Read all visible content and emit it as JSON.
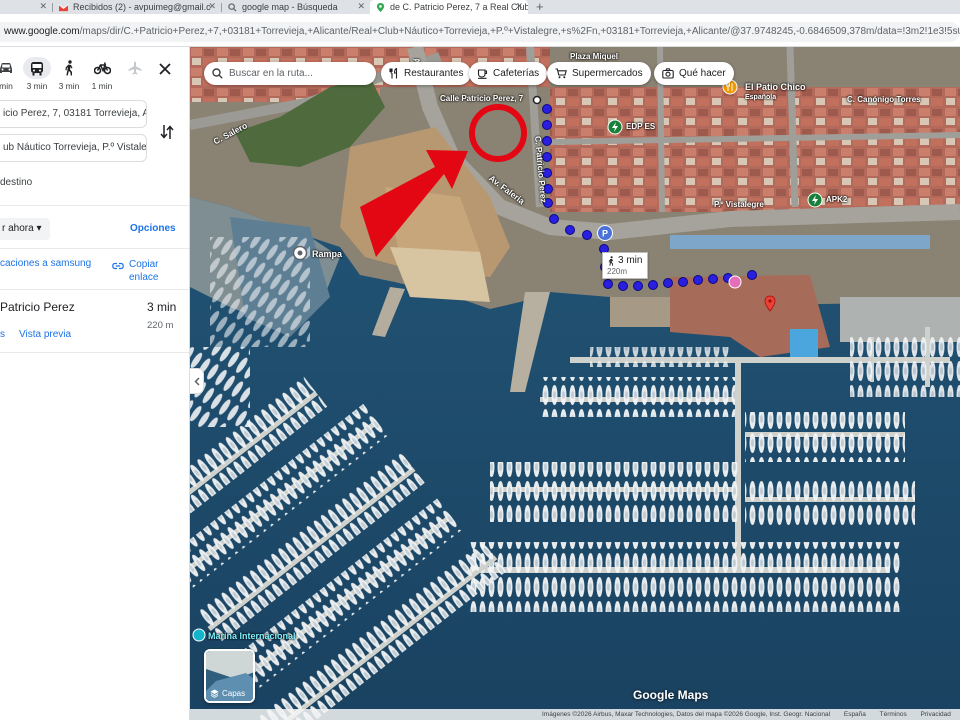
{
  "browser": {
    "tabs": [
      {
        "label": "",
        "active": false
      },
      {
        "label": "Recibidos (2) - avpuimeg@gmail.c",
        "active": false
      },
      {
        "label": "google map - Búsqueda",
        "active": false
      },
      {
        "label": "de C. Patricio Perez, 7 a Real Club",
        "active": true
      }
    ],
    "url_host": "www.google.com",
    "url_path": "/maps/dir/C.+Patricio+Perez,+7,+03181+Torrevieja,+Alicante/Real+Club+Náutico+Torrevieja,+P.º+Vistalegre,+s%2Fn,+03181+Torrevieja,+Alicante/@37.9748245,-0.6846509,378m/data=!3m2!1e3!5s0x63075..."
  },
  "panel": {
    "modes": [
      {
        "icon": "car-icon",
        "label": "min"
      },
      {
        "icon": "transit-icon",
        "label": "3 min",
        "selected": true
      },
      {
        "icon": "walk-icon",
        "label": "3 min"
      },
      {
        "icon": "bike-icon",
        "label": "1 min"
      },
      {
        "icon": "flight-icon",
        "label": ""
      }
    ],
    "origin": "icio Perez, 7, 03181 Torrevieja, Alica",
    "destination": "ub Náutico Torrevieja, P.º Vistalegre",
    "add_destination": "destino",
    "leave_now": "r ahora",
    "options": "Opciones",
    "send_to_device": "caciones a samsung",
    "copy_link": [
      "Copiar",
      "enlace"
    ],
    "route": {
      "name": "Patricio Perez",
      "time": "3 min",
      "distance": "220 m",
      "steps": "s",
      "preview": "Vista previa"
    }
  },
  "map": {
    "search_placeholder": "Buscar en la ruta...",
    "chips": [
      {
        "icon": "restaurant-icon",
        "label": "Restaurantes"
      },
      {
        "icon": "cafe-icon",
        "label": "Cafeterías"
      },
      {
        "icon": "cart-icon",
        "label": "Supermercados"
      },
      {
        "icon": "camera-icon",
        "label": "Qué hacer"
      }
    ],
    "labels": {
      "plaza_miquel": "Plaza Miquel",
      "calle_patricio": "Calle Patricio Perez, 7",
      "patio_chico": "El Patio Chico",
      "patio_chico_sub": "Española",
      "canonigo": "C. Canónigo Torres",
      "edp": "EDP ES",
      "vistalegre": "P.º Vistalegre",
      "apk2": "APK2",
      "salero": "C. Salero",
      "faleria": "Av. Faleria",
      "c_patricio": "C. Patricio Perez",
      "av_top": "Av.",
      "rampa": "Rampa",
      "marina": "Marina Internacional"
    },
    "walk": {
      "time": "3 min",
      "distance": "220m"
    },
    "layers_label": "Capas",
    "brand": "Google Maps",
    "attribution": [
      "Imágenes ©2026 Airbus, Maxar Technologies, Datos del mapa ©2026 Google, Inst. Geogr. Nacional",
      "España",
      "Términos",
      "Privacidad"
    ]
  },
  "colors": {
    "route_dot": "#1a1ae6",
    "annotation_red": "#e30613",
    "link_blue": "#1a73e8",
    "sea": "#1c4a6b"
  }
}
